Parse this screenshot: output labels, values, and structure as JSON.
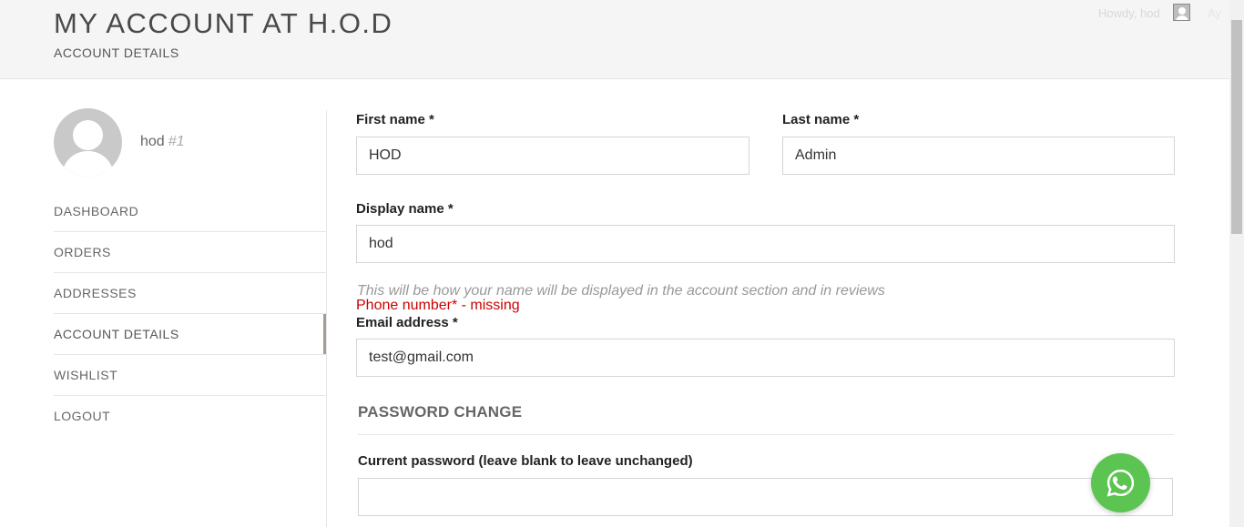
{
  "header": {
    "title": "MY ACCOUNT AT H.O.D",
    "subtitle": "ACCOUNT DETAILS",
    "howdy": "Howdy, hod",
    "howdy_extra": "Ay"
  },
  "sidebar": {
    "user_name": "hod",
    "user_id": "#1",
    "items": [
      {
        "label": "DASHBOARD"
      },
      {
        "label": "ORDERS"
      },
      {
        "label": "ADDRESSES"
      },
      {
        "label": "ACCOUNT DETAILS",
        "active": true
      },
      {
        "label": "WISHLIST"
      },
      {
        "label": "LOGOUT"
      }
    ]
  },
  "form": {
    "first_name_label": "First name *",
    "first_name_value": "HOD",
    "last_name_label": "Last name *",
    "last_name_value": "Admin",
    "display_name_label": "Display name *",
    "display_name_value": "hod",
    "display_name_hint": "This will be how your name will be displayed in the account section and in reviews",
    "phone_error": "Phone number* - missing",
    "email_label": "Email address *",
    "email_value": "test@gmail.com",
    "password_section_title": "PASSWORD CHANGE",
    "current_password_label": "Current password (leave blank to leave unchanged)",
    "current_password_value": ""
  },
  "icons": {
    "whatsapp": "whatsapp-icon",
    "avatar": "user-avatar-icon"
  },
  "colors": {
    "whatsapp_green": "#5cc451",
    "error_red": "#cc0000",
    "active_marker": "#a39d94"
  }
}
